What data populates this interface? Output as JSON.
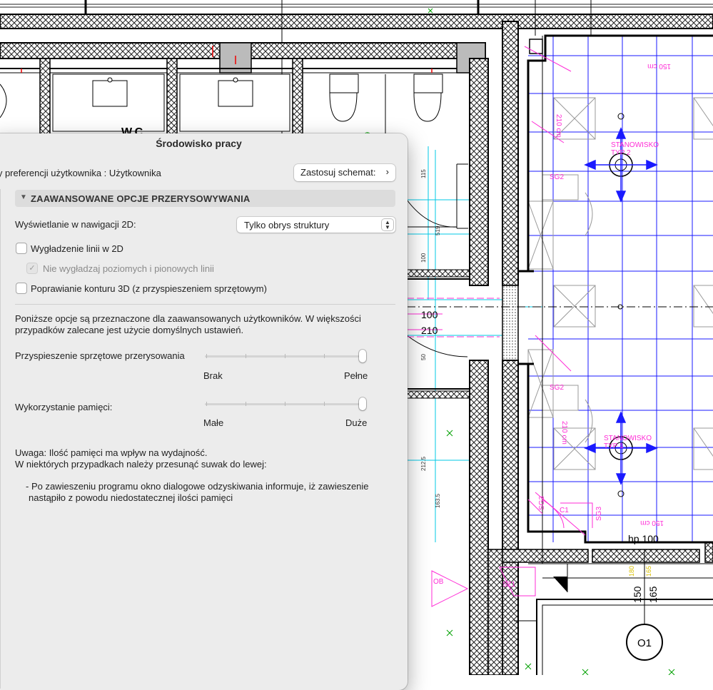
{
  "dialog": {
    "title": "Środowisko pracy",
    "scheme_label": "aty preferencji użytkownika :  Użytkownika",
    "apply_scheme_button": "Zastosuj schemat:",
    "section_title": "ZAAWANSOWANE OPCJE PRZERYSOWYWANIA",
    "nav2d_label": "Wyświetlanie w nawigacji 2D:",
    "nav2d_value": "Tylko obrys struktury",
    "smooth_lines_label": "Wygładzenie linii w 2D",
    "smooth_lines_checked": false,
    "no_smooth_hv_label": "Nie wygładzaj poziomych i pionowych linii",
    "no_smooth_hv_checked": true,
    "contour3d_label": "Poprawianie konturu 3D (z przyspieszeniem sprzętowym)",
    "contour3d_checked": false,
    "info_line1": "Poniższe opcje są przeznaczone dla zaawansowanych użytkowników. W większości",
    "info_line2": "przypadków zalecane jest użycie domyślnych ustawień.",
    "hw_accel_label": "Przyspieszenie sprzętowe przerysowania",
    "hw_accel_min": "Brak",
    "hw_accel_max": "Pełne",
    "hw_accel_value": 1.0,
    "memory_label": "Wykorzystanie pamięci:",
    "memory_min": "Małe",
    "memory_max": "Duże",
    "memory_value": 1.0,
    "note_line1": "Uwaga: Ilość pamięci ma wpływ na wydajność.",
    "note_line2": "W niektórych przypadkach należy przesunąć suwak do lewej:",
    "bullet_line1": "- Po zawieszeniu programu okno dialogowe odzyskiwania informuje, iż zawieszenie",
    "bullet_line2": "nastąpiło z powodu niedostatecznej ilości pamięci"
  },
  "drawing": {
    "room_wc": "W.C",
    "dim_100": "100",
    "dim_210": "210",
    "ws2_line1": "STANOWISKO",
    "ws2_line2": "TYP 2",
    "ws1_line1": "STANOWISKO",
    "ws1_line2": "TYP 1",
    "sg2_top": "SG2",
    "sg2_mid": "SG2",
    "sg3": "SG3",
    "sg3_b": "SG3",
    "c1": "C1",
    "ob": "OB",
    "sz1": "SZ1",
    "dim_150cm_top": "150 cm",
    "dim_150cm_bottom": "150 cm",
    "dim_210cm_a": "210 cm",
    "dim_210cm_b": "210 cm",
    "hp": "hp 100",
    "v150": "150",
    "v165": "165",
    "o1": "O1",
    "small_115": "115",
    "small_519": "519",
    "small_100": "100",
    "small_50": "50",
    "small_2125": "212.5",
    "small_1635": "163.5",
    "small_180": "180",
    "small_165": "165",
    "small_9": "9"
  }
}
